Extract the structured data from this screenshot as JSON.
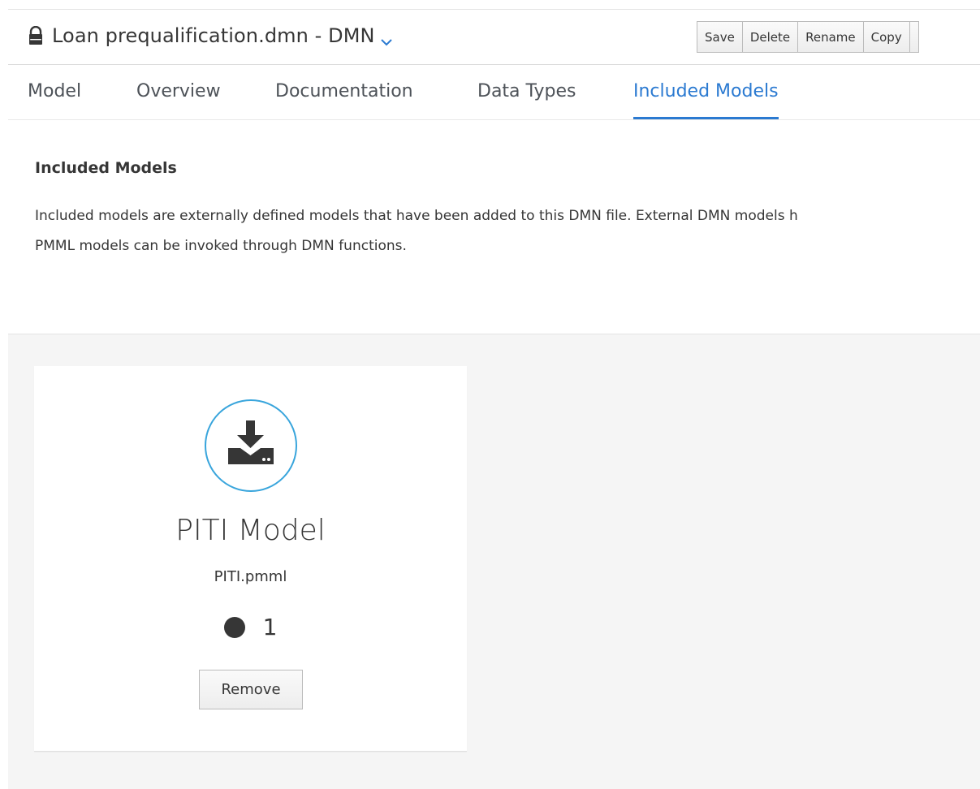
{
  "header": {
    "lock_icon": "lock-icon",
    "title": "Loan prequalification.dmn - DMN",
    "chevron_icon": "chevron-down-icon"
  },
  "toolbar": {
    "buttons": [
      "Save",
      "Delete",
      "Rename",
      "Copy"
    ]
  },
  "tabs": {
    "items": [
      "Model",
      "Overview",
      "Documentation",
      "Data Types",
      "Included Models"
    ],
    "active": "Included Models"
  },
  "section": {
    "heading": "Included Models",
    "description_line1": "Included models are externally defined models that have been added to this DMN file. External DMN models h",
    "description_line2": "PMML models can be invoked through DMN functions."
  },
  "card": {
    "icon": "import-icon",
    "title": "PITI Model",
    "file": "PITI.pmml",
    "count": "1",
    "remove_label": "Remove"
  },
  "colors": {
    "accent": "#2b7ad1",
    "icon_ring": "#39a5dc",
    "text": "#363636",
    "grey_bg": "#f5f5f5"
  }
}
